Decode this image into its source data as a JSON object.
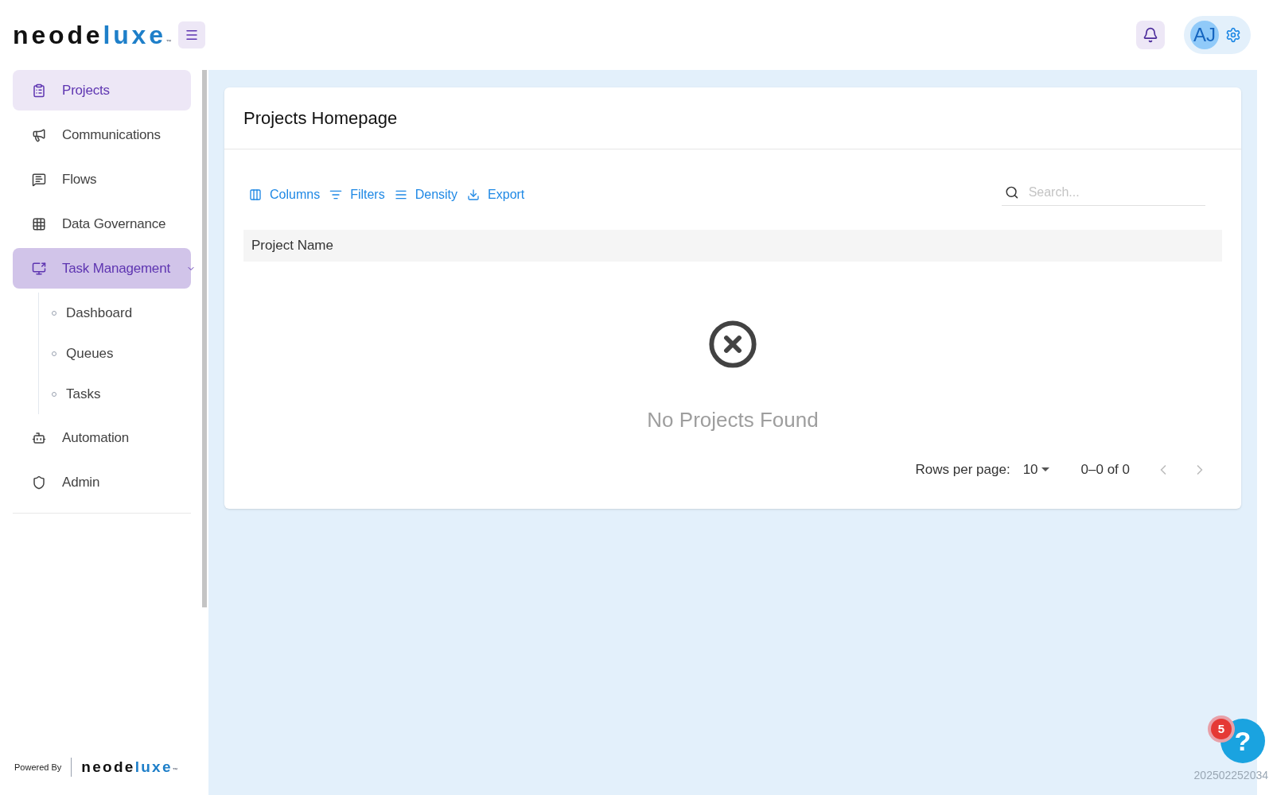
{
  "logo": {
    "parts": [
      "neode",
      "luxe",
      "™"
    ]
  },
  "header": {
    "avatar_initials": "AJ"
  },
  "sidebar": {
    "items": [
      {
        "label": "Projects",
        "selected": true,
        "hovered": false
      },
      {
        "label": "Communications",
        "selected": false,
        "hovered": false
      },
      {
        "label": "Flows",
        "selected": false,
        "hovered": false
      },
      {
        "label": "Data Governance",
        "selected": false,
        "hovered": false
      },
      {
        "label": "Task Management",
        "selected": false,
        "hovered": true,
        "expanded": true,
        "children": [
          {
            "label": "Dashboard",
            "selected": false
          },
          {
            "label": "Queues",
            "selected": false
          },
          {
            "label": "Tasks",
            "selected": false
          }
        ]
      },
      {
        "label": "Automation",
        "selected": false,
        "hovered": false
      },
      {
        "label": "Admin",
        "selected": false,
        "hovered": false
      }
    ],
    "footer": {
      "powered_by": "Powered By",
      "logo_parts": [
        "neode",
        "luxe",
        "™"
      ]
    }
  },
  "card": {
    "title": "Projects Homepage",
    "toolbar": [
      {
        "label": "Columns"
      },
      {
        "label": "Filters"
      },
      {
        "label": "Density"
      },
      {
        "label": "Export"
      }
    ],
    "search": {
      "placeholder": "Search..."
    },
    "table": {
      "columns": [
        "Project Name"
      ],
      "empty_message": "No Projects Found"
    },
    "pagination": {
      "rows_per_page_label": "Rows per page:",
      "rows_per_page": "10",
      "range": "0–0 of 0",
      "prev_disabled": true,
      "next_disabled": true
    }
  },
  "help": {
    "badge": "5",
    "icon_text": "?"
  },
  "build_id": "202502252034"
}
